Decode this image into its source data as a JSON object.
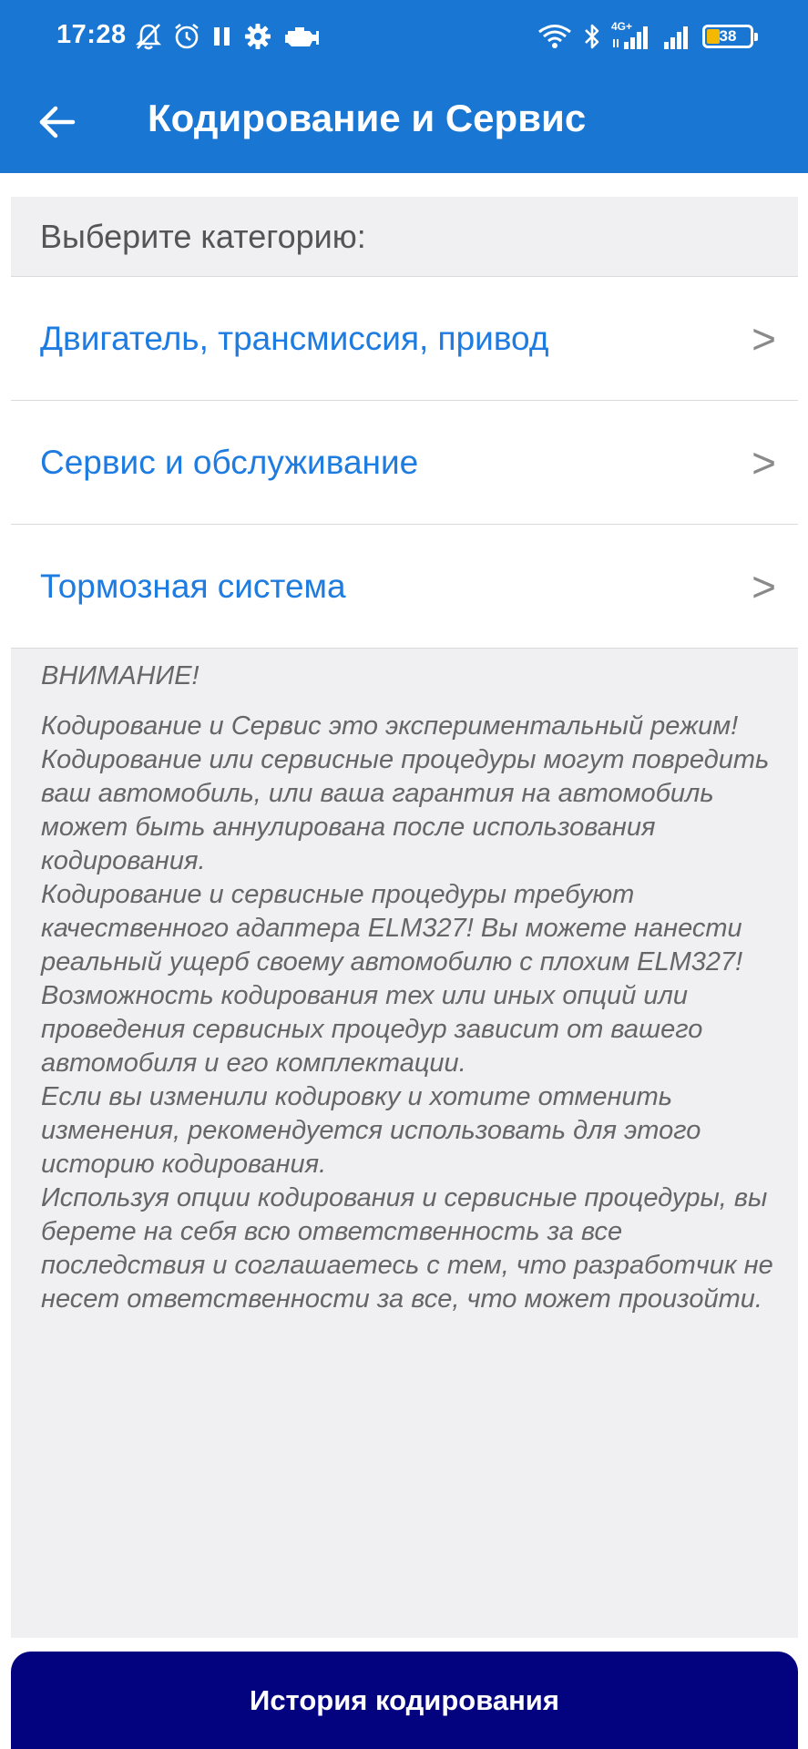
{
  "status_bar": {
    "time": "17:28",
    "battery_level": "38",
    "network_label": "4G+",
    "icons": [
      "bell-off-icon",
      "alarm-icon",
      "pause-icon",
      "gear-icon",
      "check-engine-icon",
      "wifi-icon",
      "bluetooth-icon",
      "signal-icon",
      "signal-icon",
      "battery-icon"
    ]
  },
  "app_bar": {
    "title": "Кодирование и Сервис",
    "back_icon": "arrow-left-icon"
  },
  "content": {
    "category_prompt": "Выберите категорию:",
    "categories": [
      {
        "label": "Двигатель, трансмиссия, привод",
        "arrow": ">"
      },
      {
        "label": "Сервис и обслуживание",
        "arrow": ">"
      },
      {
        "label": "Тормозная система",
        "arrow": ">"
      }
    ],
    "warning": {
      "title": "ВНИМАНИЕ!",
      "paragraphs": [
        "Кодирование и Сервис это экспериментальный режим! Кодирование или сервисные процедуры могут повредить ваш автомобиль, или ваша гарантия на автомобиль может быть аннулирована после использования кодирования.",
        "Кодирование и сервисные процедуры требуют качественного адаптера ELM327! Вы можете нанести реальный ущерб своему автомобилю с плохим ELM327!",
        "Возможность кодирования тех или иных опций или проведения сервисных процедур зависит от вашего автомобиля и его комплектации.",
        "Если вы изменили кодировку и хотите отменить изменения, рекомендуется использовать для этого историю кодирования.",
        "Используя опции кодирования и сервисные процедуры, вы берете на себя всю ответственность за все последствия и соглашаетесь с тем, что разработчик не несет ответственности за все, что может произойти."
      ]
    }
  },
  "footer": {
    "history_button_label": "История кодирования"
  },
  "colors": {
    "app_bar": "#1976D2",
    "link": "#1E7BE0",
    "content_bg": "#F0F0F3",
    "button": "#03037F",
    "battery_accent": "#F5B800"
  }
}
